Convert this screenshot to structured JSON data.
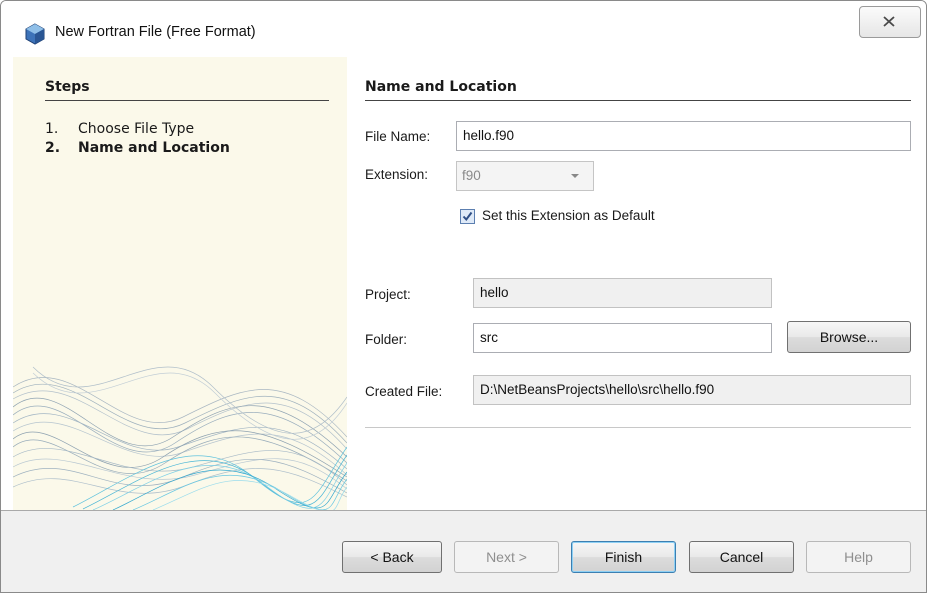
{
  "window": {
    "title": "New Fortran File (Free Format)",
    "close_glyph": "✕"
  },
  "steps": {
    "title": "Steps",
    "items": [
      {
        "num": "1.",
        "label": "Choose File Type",
        "current": false
      },
      {
        "num": "2.",
        "label": "Name and Location",
        "current": true
      }
    ]
  },
  "form": {
    "section_title": "Name and Location",
    "file_name_label": "File Name:",
    "file_name_value": "hello.f90",
    "extension_label": "Extension:",
    "extension_value": "f90",
    "set_default_label": "Set this Extension as Default",
    "set_default_checked": true,
    "project_label": "Project:",
    "project_value": "hello",
    "folder_label": "Folder:",
    "folder_value": "src",
    "browse_label": "Browse...",
    "created_file_label": "Created File:",
    "created_file_value": "D:\\NetBeansProjects\\hello\\src\\hello.f90"
  },
  "buttons": {
    "back": "< Back",
    "next": "Next >",
    "finish": "Finish",
    "cancel": "Cancel",
    "help": "Help"
  },
  "colors": {
    "left_panel_bg": "#fbf9ea",
    "default_button_border": "#3c7fb1",
    "checkbox_check": "#2f4f86"
  },
  "icons": {
    "title": "netbeans-cube-icon",
    "close": "close-icon",
    "checkbox": "checkmark-icon",
    "combo": "chevron-down-icon"
  }
}
